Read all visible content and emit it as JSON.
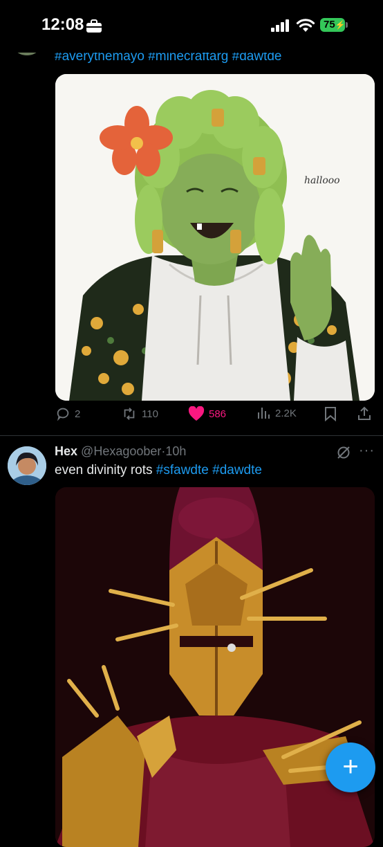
{
  "status_bar": {
    "time": "12:08",
    "battery": "75"
  },
  "prev_tweet": {
    "hashtags": [
      "#averythemayo",
      "#minecraftarg",
      "#dawtde"
    ],
    "image_text": "hallooo",
    "actions": {
      "replies": "2",
      "retweets": "110",
      "likes": "586",
      "views": "2.2K"
    }
  },
  "tweet": {
    "name": "Hex",
    "handle": "@Hexagoober",
    "sep": "·",
    "time": "10h",
    "text": "even divinity rots",
    "hashtags": [
      "#sfawdte",
      "#dawdte"
    ]
  },
  "fab": {
    "label": "+"
  },
  "colors": {
    "accent": "#1d9bf0",
    "like": "#f91880",
    "muted": "#71767b",
    "battery": "#34c759"
  }
}
